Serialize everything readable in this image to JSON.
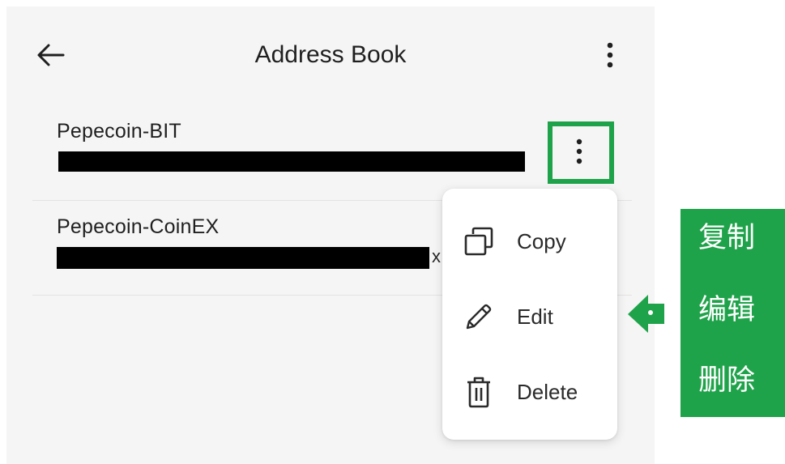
{
  "app": {
    "title": "Address Book",
    "back_icon": "arrow-left-icon",
    "overflow_icon": "more-vertical-icon",
    "background_color": "#f5f5f5"
  },
  "contacts": [
    {
      "name": "Pepecoin-BIT",
      "menu_icon": "more-vertical-icon"
    },
    {
      "name": "Pepecoin-CoinEX",
      "address_tail": "x",
      "menu_icon": "more-vertical-icon"
    }
  ],
  "context_menu": {
    "items": [
      {
        "label": "Copy",
        "icon": "copy-icon"
      },
      {
        "label": "Edit",
        "icon": "pencil-icon"
      },
      {
        "label": "Delete",
        "icon": "trash-icon"
      }
    ]
  },
  "annotation": {
    "color": "#1fa34a",
    "arrow_icon": "arrow-left-annotation-icon",
    "labels": [
      "复制",
      "编辑",
      "删除"
    ]
  }
}
